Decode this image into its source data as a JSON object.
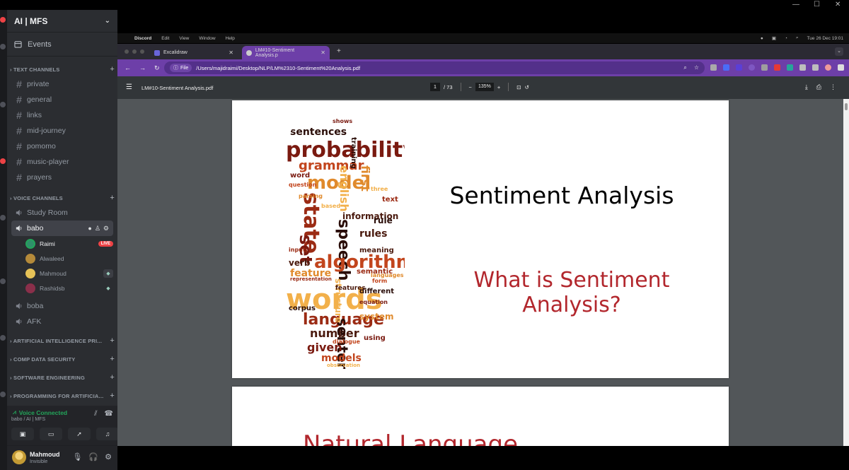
{
  "window": {
    "controls": [
      "—",
      "☐",
      "✕"
    ]
  },
  "server": {
    "name": "AI | MFS",
    "events_label": "Events"
  },
  "text_channels": {
    "header": "TEXT CHANNELS",
    "items": [
      "private",
      "general",
      "links",
      "mid-journey",
      "pomomo",
      "music-player",
      "prayers"
    ]
  },
  "voice_channels": {
    "header": "VOICE CHANNELS",
    "study_room": "Study Room",
    "active_channel": "babo",
    "members": [
      {
        "name": "Raimi",
        "badge": "LIVE"
      },
      {
        "name": "Alwaleed"
      },
      {
        "name": "Mahmoud"
      },
      {
        "name": "Rashidsb"
      }
    ],
    "others": [
      "boba",
      "AFK"
    ]
  },
  "categories": [
    "ARTIFICIAL INTELLIGENCE PRI...",
    "COMP DATA SECURITY",
    "SOFTWARE ENGINEERING",
    "PROGRAMMING FOR ARTIFICIA..."
  ],
  "voice_panel": {
    "status": "Voice Connected",
    "location": "babo / AI | MFS"
  },
  "user": {
    "name": "Mahmoud",
    "status": "Invisible"
  },
  "mac_menu": {
    "app": "Discord",
    "items": [
      "Edit",
      "View",
      "Window",
      "Help"
    ],
    "clock": "Tue 26 Dec  19:01"
  },
  "browser": {
    "tabs": [
      {
        "title": "Excalidraw"
      },
      {
        "title": "LM#10-Sentiment Analysis.p"
      }
    ],
    "address_chip": "File",
    "url": "/Users/majidraimi/Desktop/NLP/LM%2310-Sentiment%20Analysis.pdf"
  },
  "pdf": {
    "filename": "LM#10-Sentiment Analysis.pdf",
    "page_current": "1",
    "page_total": "/ 73",
    "zoom": "135%",
    "zoom_minus": "−",
    "zoom_plus": "+"
  },
  "slide1": {
    "title": "Sentiment Analysis",
    "subtitle": "What is Sentiment Analysis?"
  },
  "slide2": {
    "title": "Natural Language"
  },
  "colors": {
    "accent_purple": "#6d3fa8",
    "live_red": "#ed4245",
    "voice_green": "#23a55a",
    "slide_red": "#b2272d"
  }
}
